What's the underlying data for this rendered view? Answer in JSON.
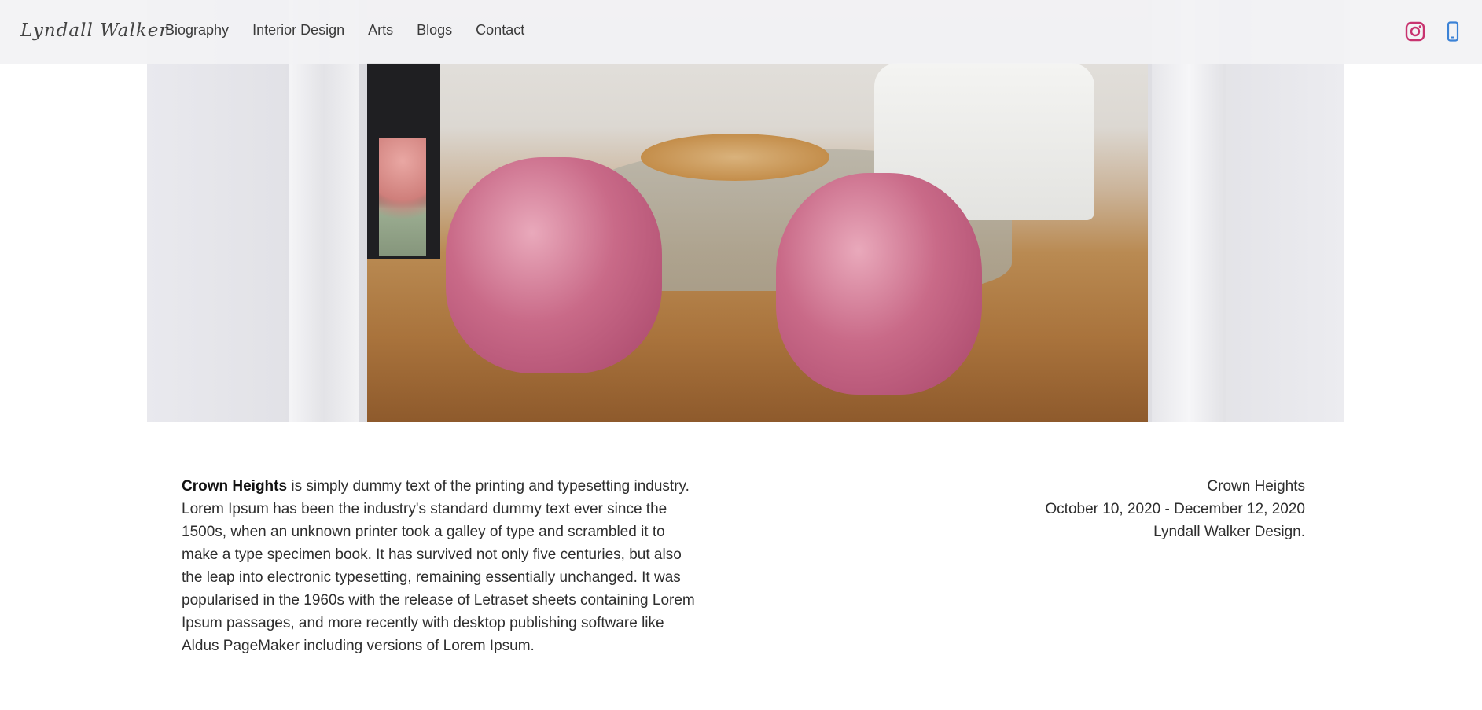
{
  "header": {
    "logo": "Lyndall Walker",
    "nav": [
      "Biography",
      "Interior Design",
      "Arts",
      "Blogs",
      "Contact"
    ],
    "social_icons": [
      "instagram-icon",
      "phone-icon"
    ]
  },
  "hero": {
    "image": "living-room-pink-chairs"
  },
  "content": {
    "title_bold": "Crown Heights",
    "description": " is simply dummy text of the printing and typesetting industry. Lorem Ipsum has been the industry's standard dummy text ever since the 1500s, when an unknown printer took a galley of type and scrambled it to make a type specimen book. It has survived not only five centuries, but also the leap into electronic typesetting, remaining essentially unchanged. It was popularised in the 1960s with the release of Letraset sheets containing Lorem Ipsum passages, and more recently with desktop publishing software like Aldus PageMaker including versions of Lorem Ipsum.",
    "meta": {
      "project": "Crown Heights",
      "dates": "October 10, 2020 - December 12, 2020",
      "designer": "Lyndall Walker Design."
    }
  },
  "colors": {
    "instagram": "#c8336f",
    "phone": "#3b82d6"
  }
}
